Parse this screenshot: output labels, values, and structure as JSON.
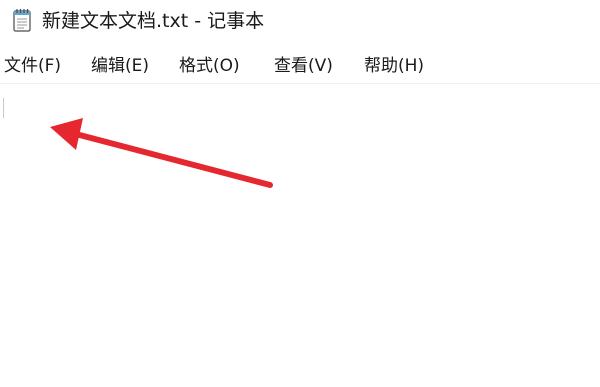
{
  "window": {
    "title": "新建文本文档.txt - 记事本",
    "icon": "notepad-icon"
  },
  "menubar": {
    "items": [
      {
        "label": "文件(F)"
      },
      {
        "label": "编辑(E)"
      },
      {
        "label": "格式(O)"
      },
      {
        "label": "查看(V)"
      },
      {
        "label": "帮助(H)"
      }
    ]
  },
  "editor": {
    "content": ""
  },
  "annotation": {
    "icon": "arrow-icon",
    "color": "#e5282f"
  }
}
